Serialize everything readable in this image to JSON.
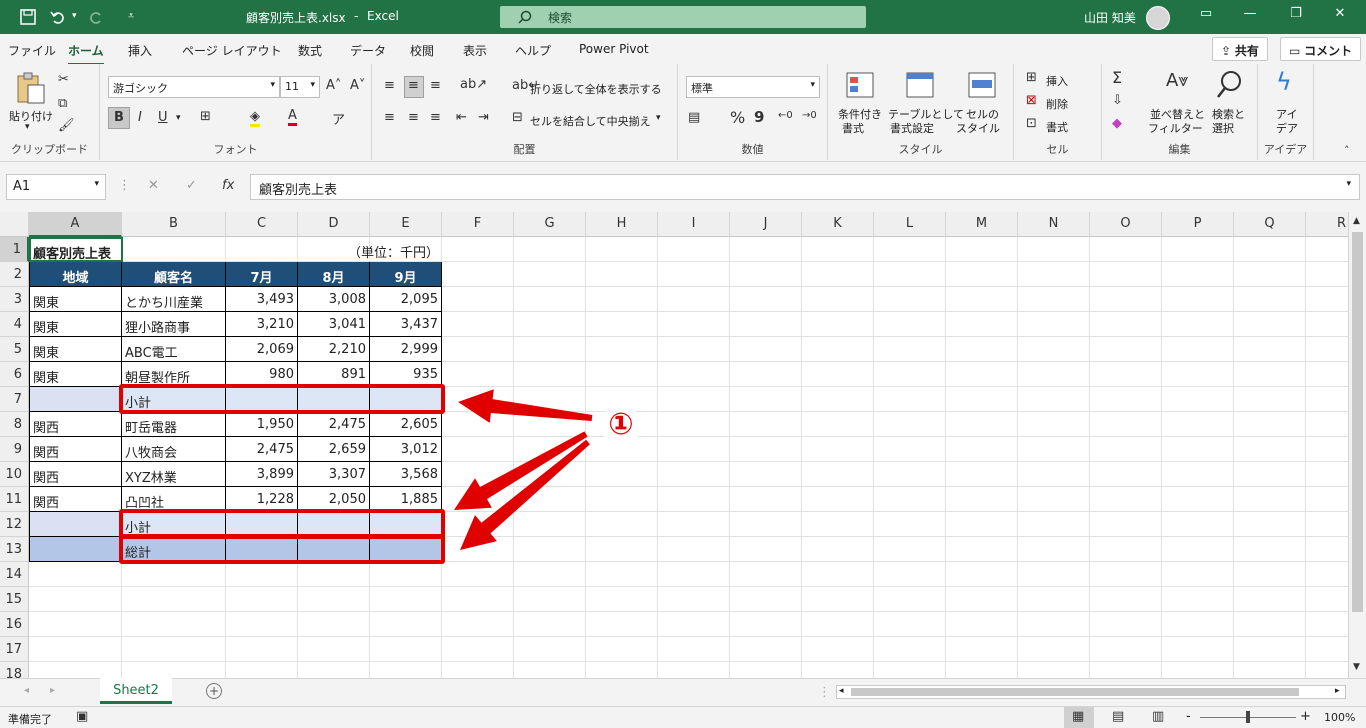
{
  "titlebar": {
    "filename": "顧客別売上表.xlsx",
    "sep": "-",
    "app": "Excel",
    "search_placeholder": "検索",
    "user": "山田 知美"
  },
  "menu": {
    "tabs": [
      "ファイル",
      "ホーム",
      "挿入",
      "ページ レイアウト",
      "数式",
      "データ",
      "校閲",
      "表示",
      "ヘルプ",
      "Power Pivot"
    ],
    "share": "共有",
    "comment": "コメント"
  },
  "ribbon": {
    "clipboard": {
      "paste": "貼り付け",
      "label": "クリップボード"
    },
    "font": {
      "name": "游ゴシック",
      "size": "11",
      "label": "フォント",
      "bold": "B",
      "italic": "I",
      "underline": "U"
    },
    "alignment": {
      "wrap": "折り返して全体を表示する",
      "merge": "セルを結合して中央揃え",
      "label": "配置"
    },
    "number": {
      "format": "標準",
      "label": "数値",
      "percent": "%",
      "comma": "9"
    },
    "styles": {
      "conditional": [
        "条件付き",
        "書式"
      ],
      "table": [
        "テーブルとして",
        "書式設定"
      ],
      "cell": [
        "セルの",
        "スタイル"
      ],
      "label": "スタイル"
    },
    "cells": {
      "insert": "挿入",
      "delete": "削除",
      "format": "書式",
      "label": "セル"
    },
    "editing": {
      "sort": [
        "並べ替えと",
        "フィルター"
      ],
      "find": [
        "検索と",
        "選択"
      ],
      "label": "編集"
    },
    "ideas": {
      "btn": [
        "アイ",
        "デア"
      ],
      "label": "アイデア"
    }
  },
  "formula": {
    "name_box": "A1",
    "fx": "fx",
    "content": "顧客別売上表"
  },
  "columns": [
    "A",
    "B",
    "C",
    "D",
    "E",
    "F",
    "G",
    "H",
    "I",
    "J",
    "K",
    "L",
    "M",
    "N",
    "O",
    "P",
    "Q",
    "R"
  ],
  "rows": [
    "1",
    "2",
    "3",
    "4",
    "5",
    "6",
    "7",
    "8",
    "9",
    "10",
    "11",
    "12",
    "13",
    "14",
    "15",
    "16",
    "17",
    "18"
  ],
  "sheet": {
    "title": "顧客別売上表",
    "unit": "（単位：千円）",
    "headers": [
      "地域",
      "顧客名",
      "7月",
      "8月",
      "9月"
    ],
    "data": [
      [
        "関東",
        "とかち川産業",
        "3,493",
        "3,008",
        "2,095"
      ],
      [
        "関東",
        "狸小路商事",
        "3,210",
        "3,041",
        "3,437"
      ],
      [
        "関東",
        "ABC電工",
        "2,069",
        "2,210",
        "2,999"
      ],
      [
        "関東",
        "朝昼製作所",
        "980",
        "891",
        "935"
      ],
      [
        "",
        "小計",
        "",
        "",
        ""
      ],
      [
        "関西",
        "町岳電器",
        "1,950",
        "2,475",
        "2,605"
      ],
      [
        "関西",
        "八牧商会",
        "2,475",
        "2,659",
        "3,012"
      ],
      [
        "関西",
        "XYZ林業",
        "3,899",
        "3,307",
        "3,568"
      ],
      [
        "関西",
        "凸凹社",
        "1,228",
        "2,050",
        "1,885"
      ],
      [
        "",
        "小計",
        "",
        "",
        ""
      ],
      [
        "",
        "総計",
        "",
        "",
        ""
      ]
    ]
  },
  "annotation": {
    "marker": "①",
    "color": "#e00000"
  },
  "tabs": {
    "sheet": "Sheet2",
    "add": "+"
  },
  "status": {
    "ready": "準備完了",
    "zoom": "100%",
    "minus": "-",
    "plus": "+"
  },
  "colors": {
    "header_bg": "#1f4e78",
    "subtotal_bg": "#dce6f5",
    "total_bg": "#b4c6e7",
    "accent": "#217346"
  }
}
